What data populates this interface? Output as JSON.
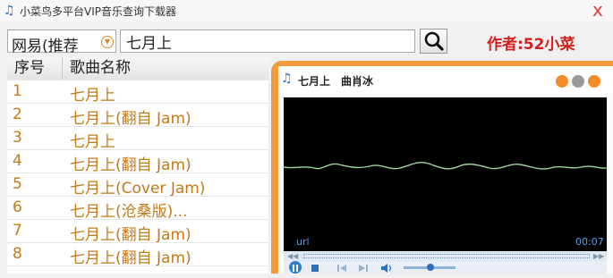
{
  "window": {
    "title": "小菜鸟多平台VIP音乐查询下载器",
    "close_glyph": "x"
  },
  "toolbar": {
    "source_value": "网易(推荐",
    "search_value": "七月上",
    "author_label": "作者:52小菜"
  },
  "list": {
    "headers": {
      "number": "序号",
      "name": "歌曲名称"
    },
    "rows": [
      {
        "num": "1",
        "title": "七月上"
      },
      {
        "num": "2",
        "title": "七月上(翻自 Jam)"
      },
      {
        "num": "3",
        "title": "七月上"
      },
      {
        "num": "4",
        "title": "七月上(翻自 Jam)"
      },
      {
        "num": "5",
        "title": "七月上(Cover Jam)"
      },
      {
        "num": "6",
        "title": "七月上(沧桑版)..."
      },
      {
        "num": "7",
        "title": "七月上(翻自 Jam)"
      },
      {
        "num": "8",
        "title": "七月上(翻自 Jam)"
      }
    ]
  },
  "player": {
    "song": "七月上",
    "artist": "曲肖冰",
    "url_label": "url",
    "time": "00:07"
  },
  "colors": {
    "accent": "#f39a3a",
    "author_red": "#d21f1f",
    "row_text": "#c07a1a",
    "wave": "#9fd69a"
  }
}
